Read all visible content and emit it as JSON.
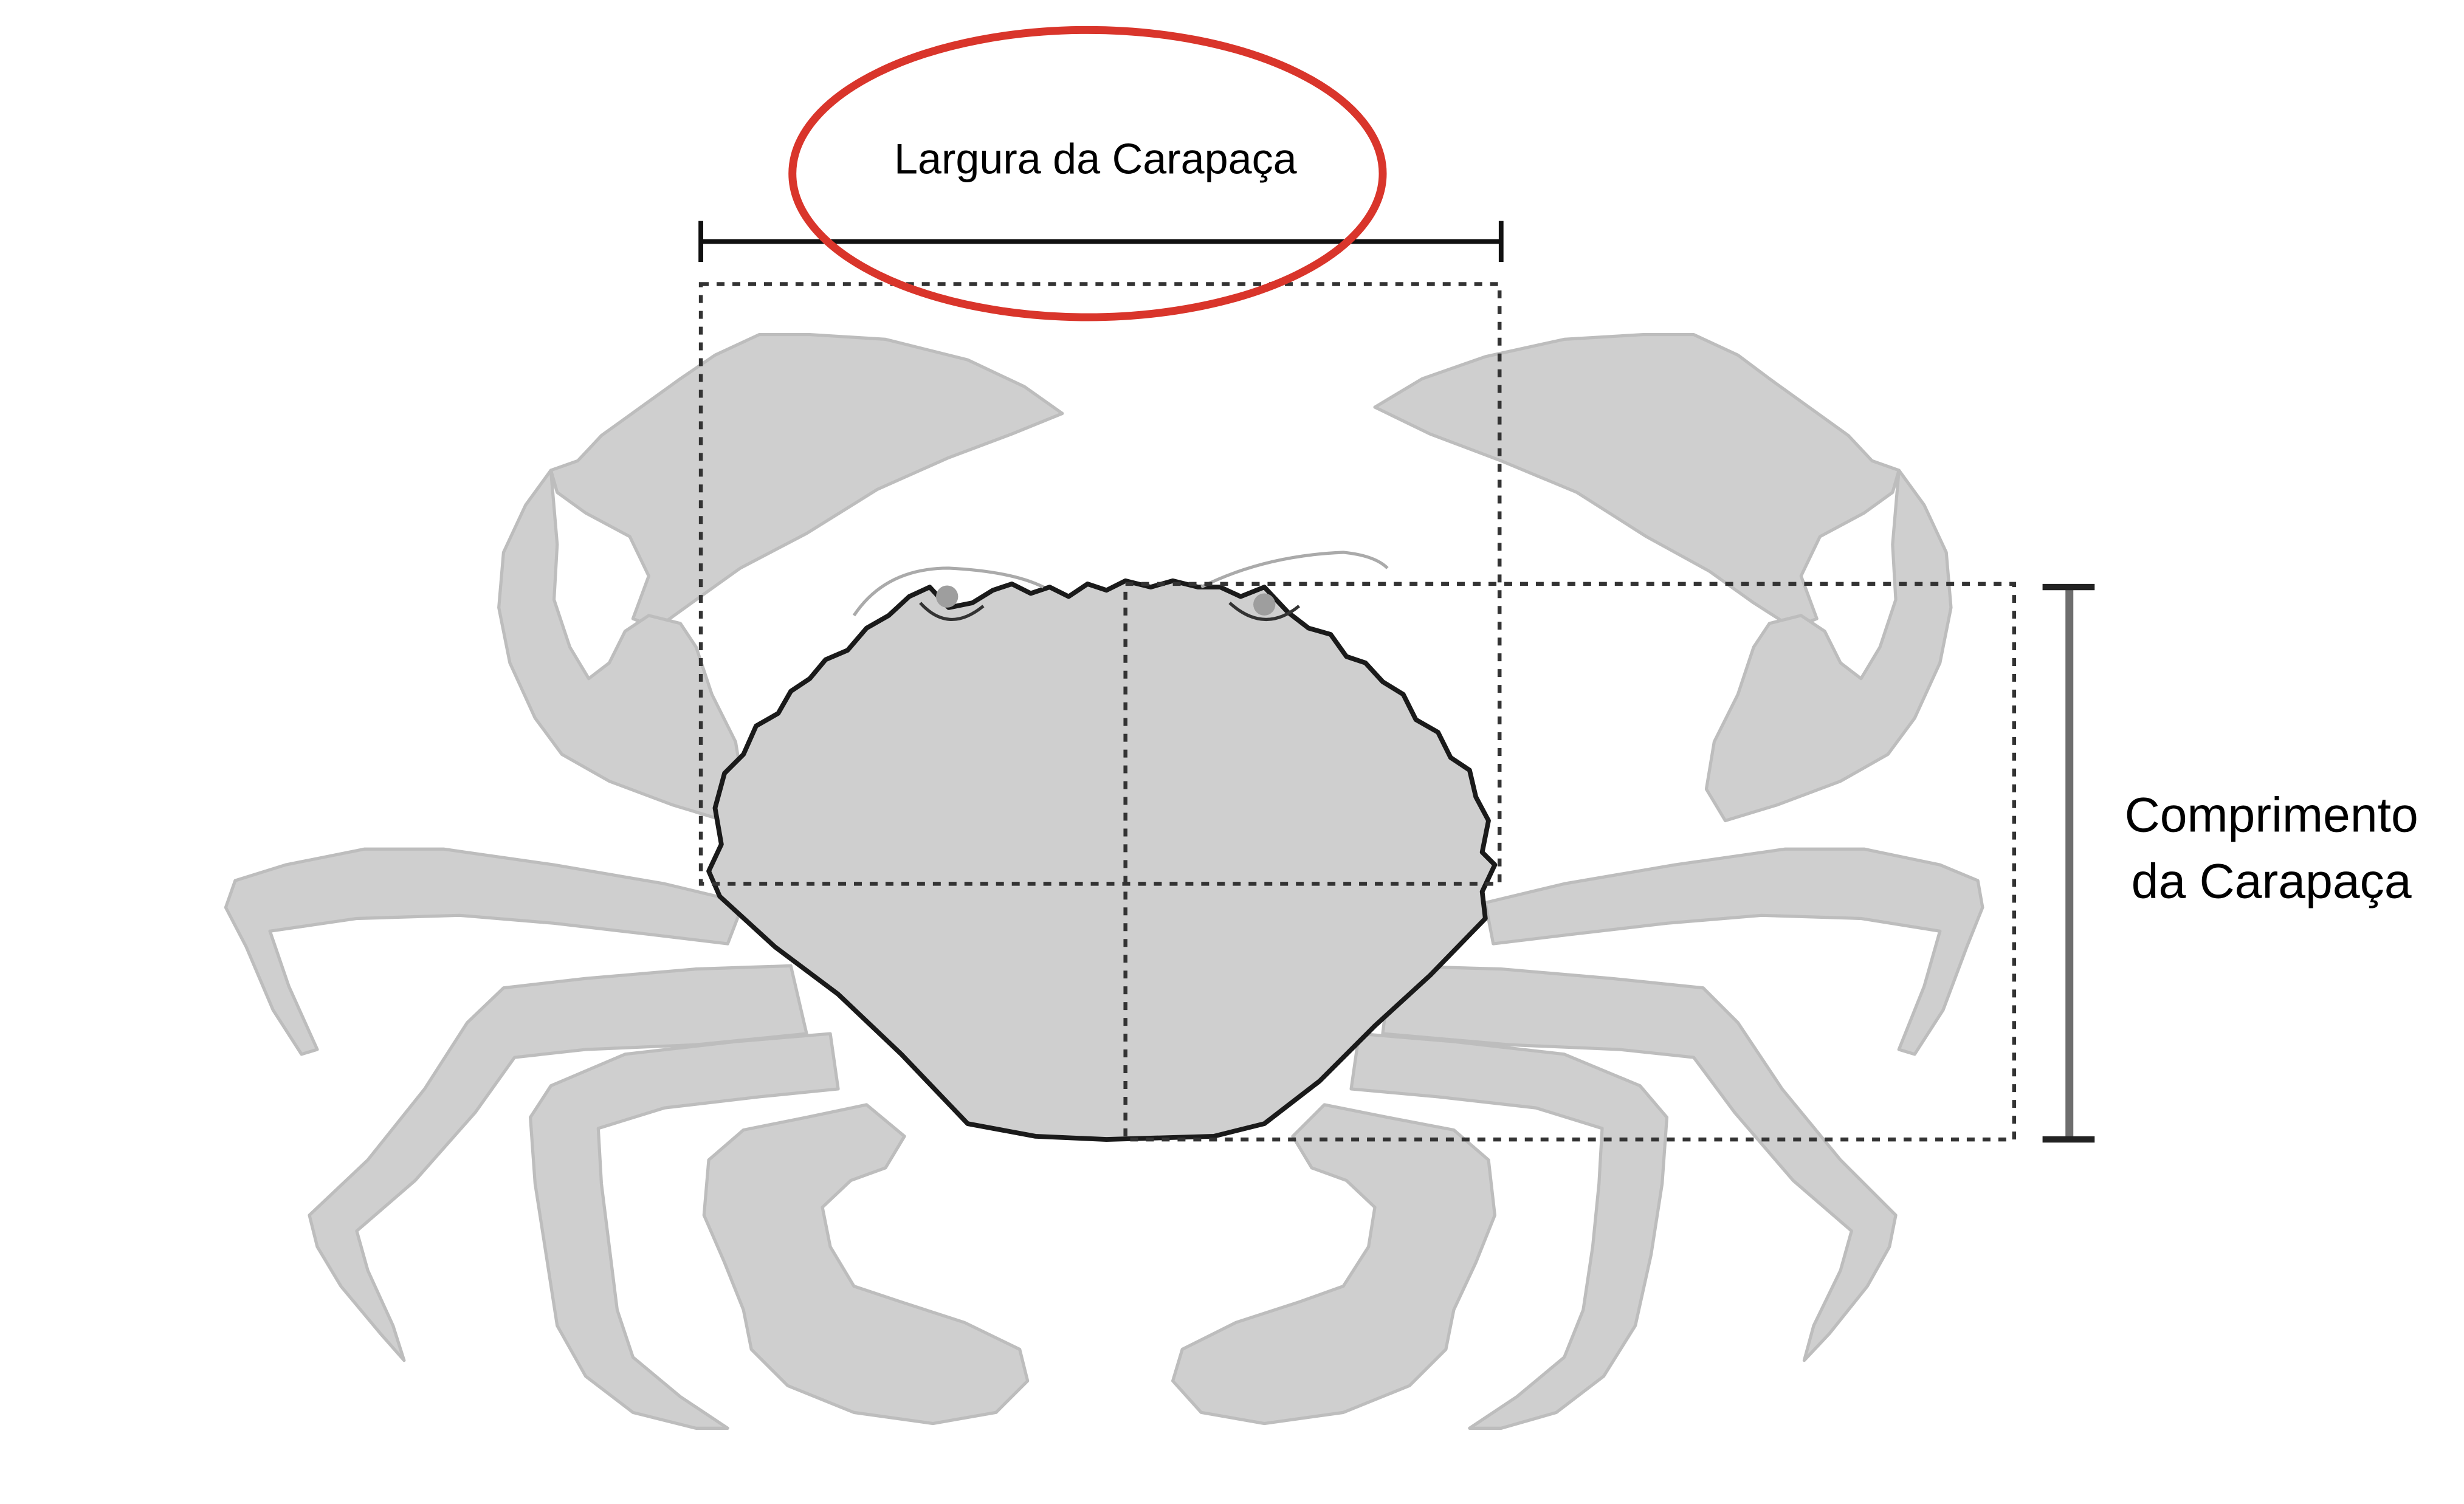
{
  "labels": {
    "width": "Largura da Carapaça",
    "length_line1": "Comprimento",
    "length_line2": "da Carapaça"
  },
  "colors": {
    "crab_fill": "#cfcfcf",
    "crab_stroke": "#bdbdbd",
    "outline": "#1a1a1a",
    "dimension_line": "#111111",
    "length_bar": "#6e6e6e",
    "highlight_ellipse": "#d9352b",
    "background": "#ffffff"
  }
}
